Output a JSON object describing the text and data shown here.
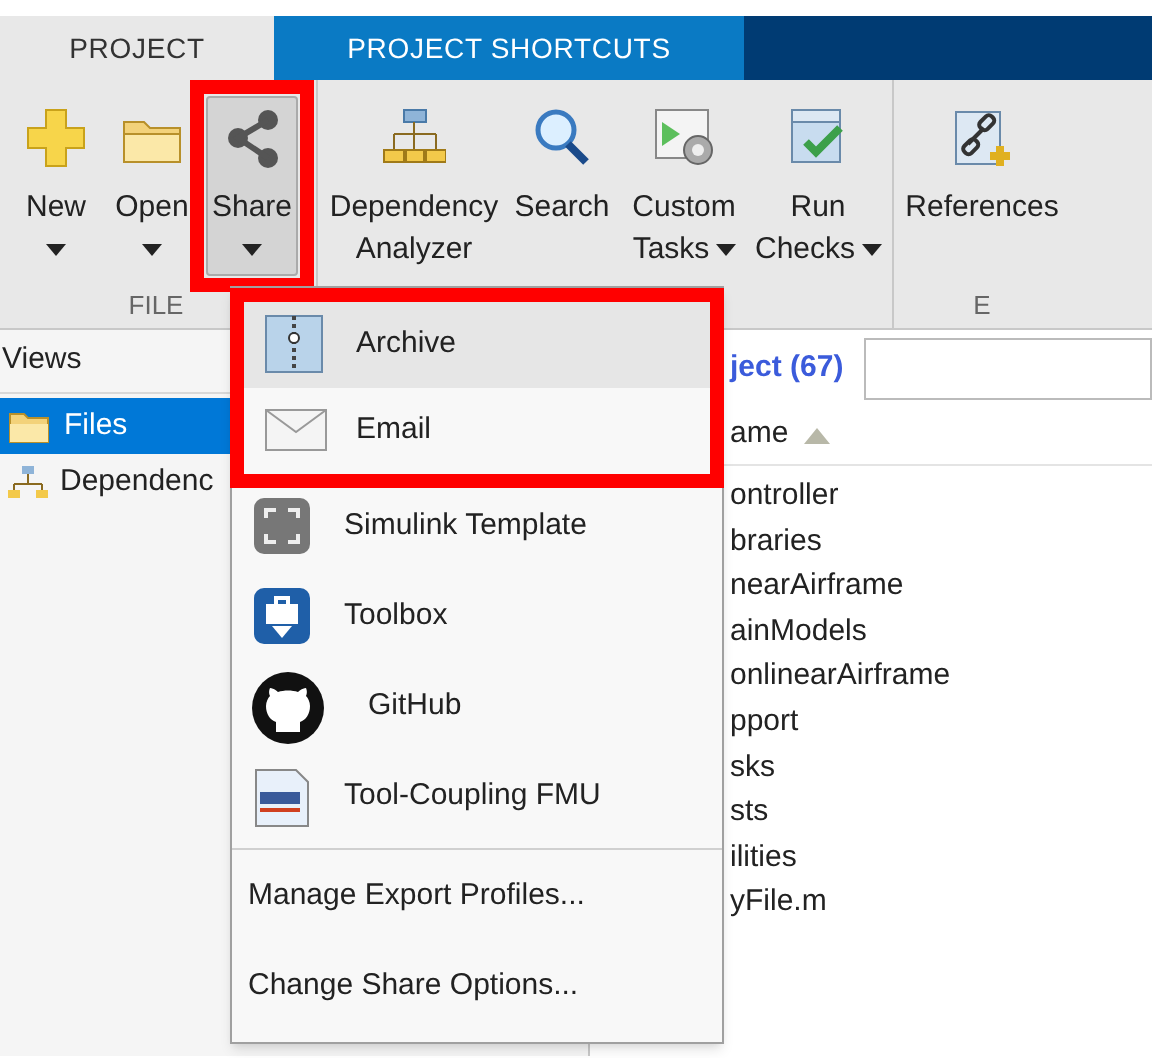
{
  "tabs": [
    {
      "label": "PROJECT",
      "selected": true
    },
    {
      "label": "PROJECT SHORTCUTS",
      "selected": false
    }
  ],
  "ribbon": {
    "groups": [
      {
        "label": "FILE",
        "buttons": [
          {
            "kind": "new",
            "label": "New",
            "dropdown": true,
            "pressed": false,
            "highlighted": false
          },
          {
            "kind": "open",
            "label": "Open",
            "dropdown": true,
            "pressed": false,
            "highlighted": false
          },
          {
            "kind": "share",
            "label": "Share",
            "dropdown": true,
            "pressed": true,
            "highlighted": true
          }
        ]
      },
      {
        "buttons": [
          {
            "kind": "dependency",
            "label": "Dependency Analyzer",
            "dropdown": false,
            "pressed": false,
            "highlighted": false
          },
          {
            "kind": "search",
            "label": "Search",
            "dropdown": false,
            "pressed": false,
            "highlighted": false
          },
          {
            "kind": "tasks",
            "label": "Custom Tasks",
            "dropdown": true,
            "pressed": false,
            "highlighted": false
          },
          {
            "kind": "checks",
            "label": "Run Checks",
            "dropdown": true,
            "pressed": false,
            "highlighted": false
          }
        ]
      },
      {
        "label": "E",
        "buttons": [
          {
            "kind": "references",
            "label": "References",
            "dropdown": false,
            "pressed": false,
            "highlighted": false
          }
        ]
      }
    ]
  },
  "views": {
    "title": "Views",
    "items": [
      {
        "kind": "files",
        "label": "Files",
        "selected": true
      },
      {
        "kind": "dependency",
        "label": "Dependenc",
        "selected": false
      }
    ]
  },
  "files": {
    "title": "ject (67)",
    "column": "ame",
    "rows": [
      "ontroller",
      "braries",
      "nearAirframe",
      "ainModels",
      "onlinearAirframe",
      "pport",
      "sks",
      "sts",
      "ilities",
      "yFile.m"
    ]
  },
  "share_menu": {
    "items": [
      {
        "kind": "archive",
        "label": "Archive",
        "selected": true,
        "highlighted": true
      },
      {
        "kind": "email",
        "label": "Email",
        "selected": false,
        "highlighted": true
      },
      {
        "kind": "template",
        "label": "Simulink Template",
        "selected": false,
        "highlighted": false
      },
      {
        "kind": "toolbox",
        "label": "Toolbox",
        "selected": false,
        "highlighted": false
      },
      {
        "kind": "github",
        "label": "GitHub",
        "selected": false,
        "highlighted": false
      },
      {
        "kind": "fmu",
        "label": "Tool-Coupling FMU",
        "selected": false,
        "highlighted": false
      }
    ],
    "actions": [
      "Manage Export Profiles...",
      "Change Share Options..."
    ]
  }
}
